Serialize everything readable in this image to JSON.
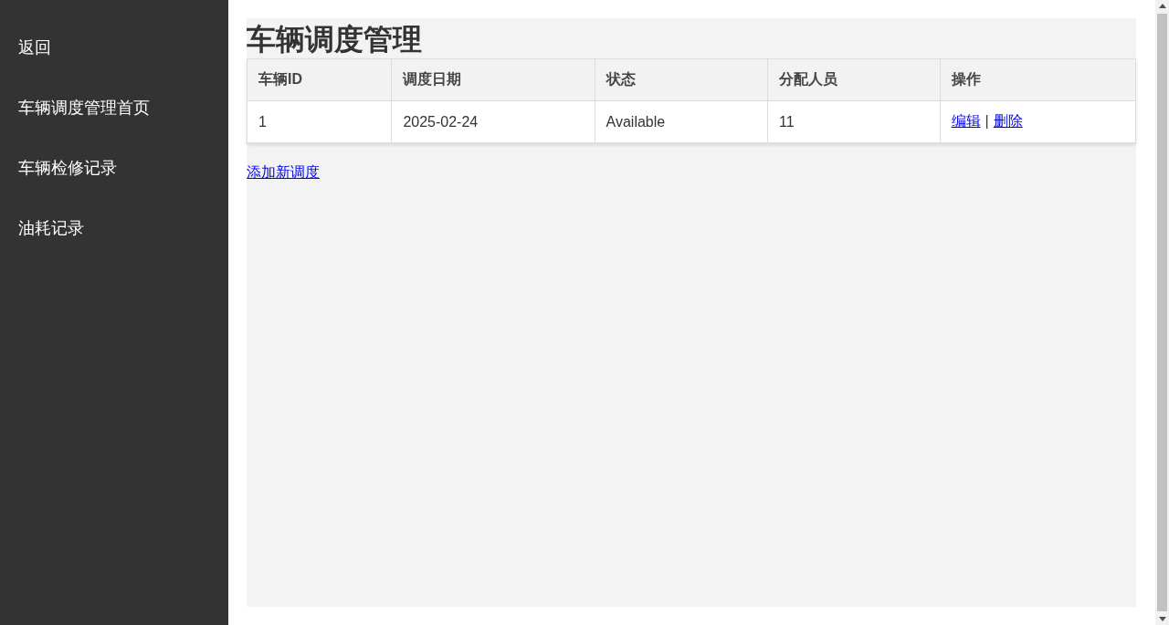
{
  "sidebar": {
    "items": [
      {
        "label": "返回"
      },
      {
        "label": "车辆调度管理首页"
      },
      {
        "label": "车辆检修记录"
      },
      {
        "label": "油耗记录"
      }
    ]
  },
  "page_title": "车辆调度管理",
  "table": {
    "columns": [
      "车辆ID",
      "调度日期",
      "状态",
      "分配人员",
      "操作"
    ],
    "rows": [
      {
        "cells": [
          "1",
          "2025-02-24",
          "Available",
          "11"
        ],
        "actions": [
          "编辑",
          "删除"
        ],
        "separator": "|"
      }
    ]
  },
  "add_link": "添加新调度"
}
